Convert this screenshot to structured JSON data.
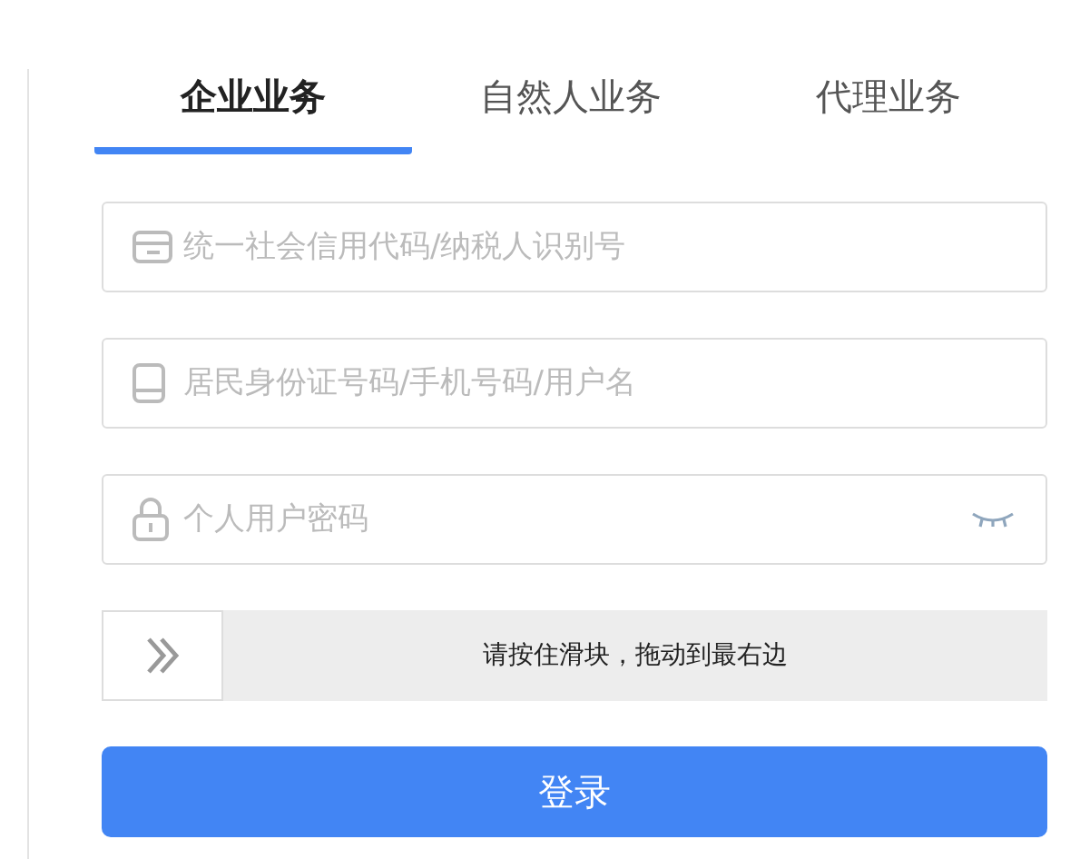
{
  "tabs": [
    {
      "label": "企业业务",
      "selected": true
    },
    {
      "label": "自然人业务",
      "selected": false
    },
    {
      "label": "代理业务",
      "selected": false
    }
  ],
  "fields": [
    {
      "kind": "text",
      "placeholder": "统一社会信用代码/纳税人识别号"
    },
    {
      "kind": "text",
      "placeholder": "居民身份证号码/手机号码/用户名"
    },
    {
      "kind": "password",
      "placeholder": "个人用户密码"
    }
  ],
  "slider": {
    "label": "请按住滑块，拖动到最右边",
    "level": 0
  },
  "login_button": "登录"
}
